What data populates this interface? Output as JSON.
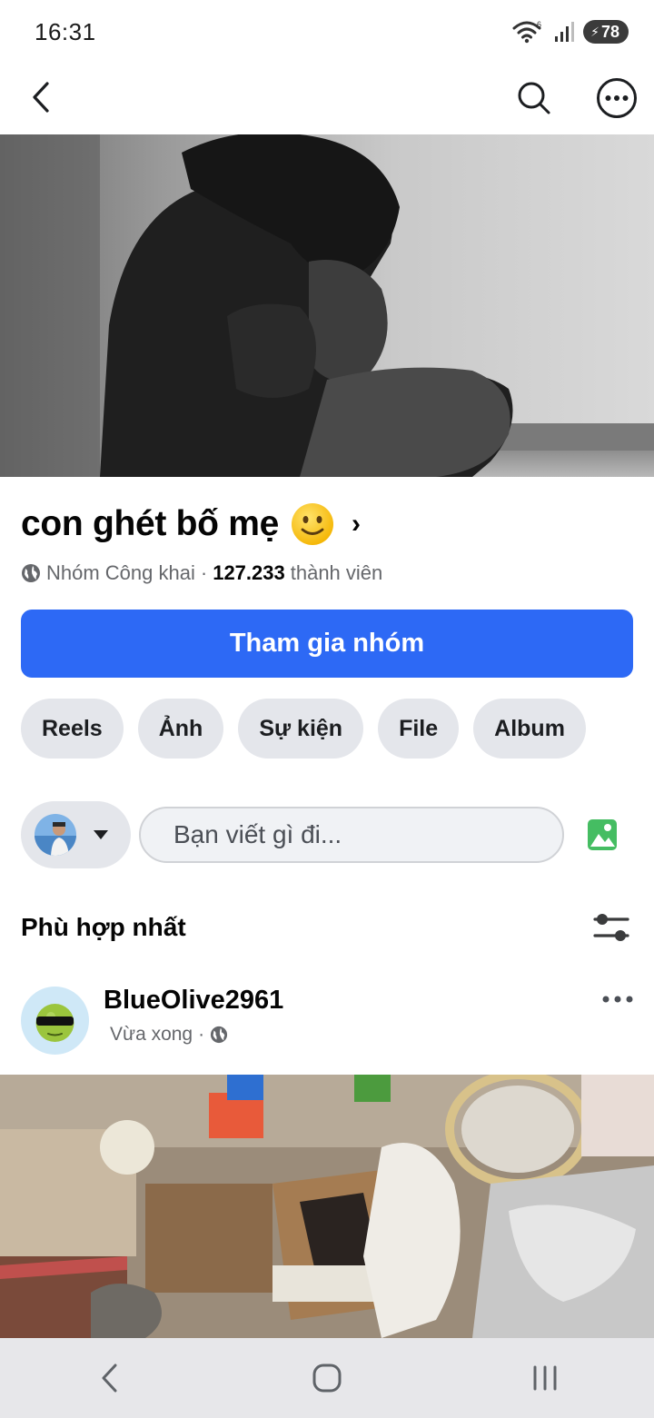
{
  "status_bar": {
    "time": "16:31",
    "battery": "78",
    "icons": [
      "wifi-icon",
      "signal-icon",
      "battery-icon"
    ]
  },
  "app_bar": {
    "icons": [
      "back-arrow-icon",
      "search-icon",
      "more-horizontal-icon"
    ]
  },
  "group": {
    "title": "con ghét bố mẹ",
    "title_emoji": "slightly-smiling-face-emoji",
    "privacy": "Nhóm Công khai",
    "separator": "·",
    "member_count": "127.233",
    "member_label": "thành viên",
    "join_button": "Tham gia nhóm",
    "accent_color": "#2d69f5"
  },
  "tabs": [
    "Reels",
    "Ảnh",
    "Sự kiện",
    "File",
    "Album"
  ],
  "composer": {
    "placeholder": "Bạn viết gì đi..."
  },
  "sort": {
    "label": "Phù hợp nhất"
  },
  "post": {
    "author": "BlueOlive2961",
    "time": "Vừa xong",
    "separator": "·"
  },
  "nav_bar": {
    "icons": [
      "back-nav-icon",
      "home-nav-icon",
      "recents-nav-icon"
    ]
  }
}
